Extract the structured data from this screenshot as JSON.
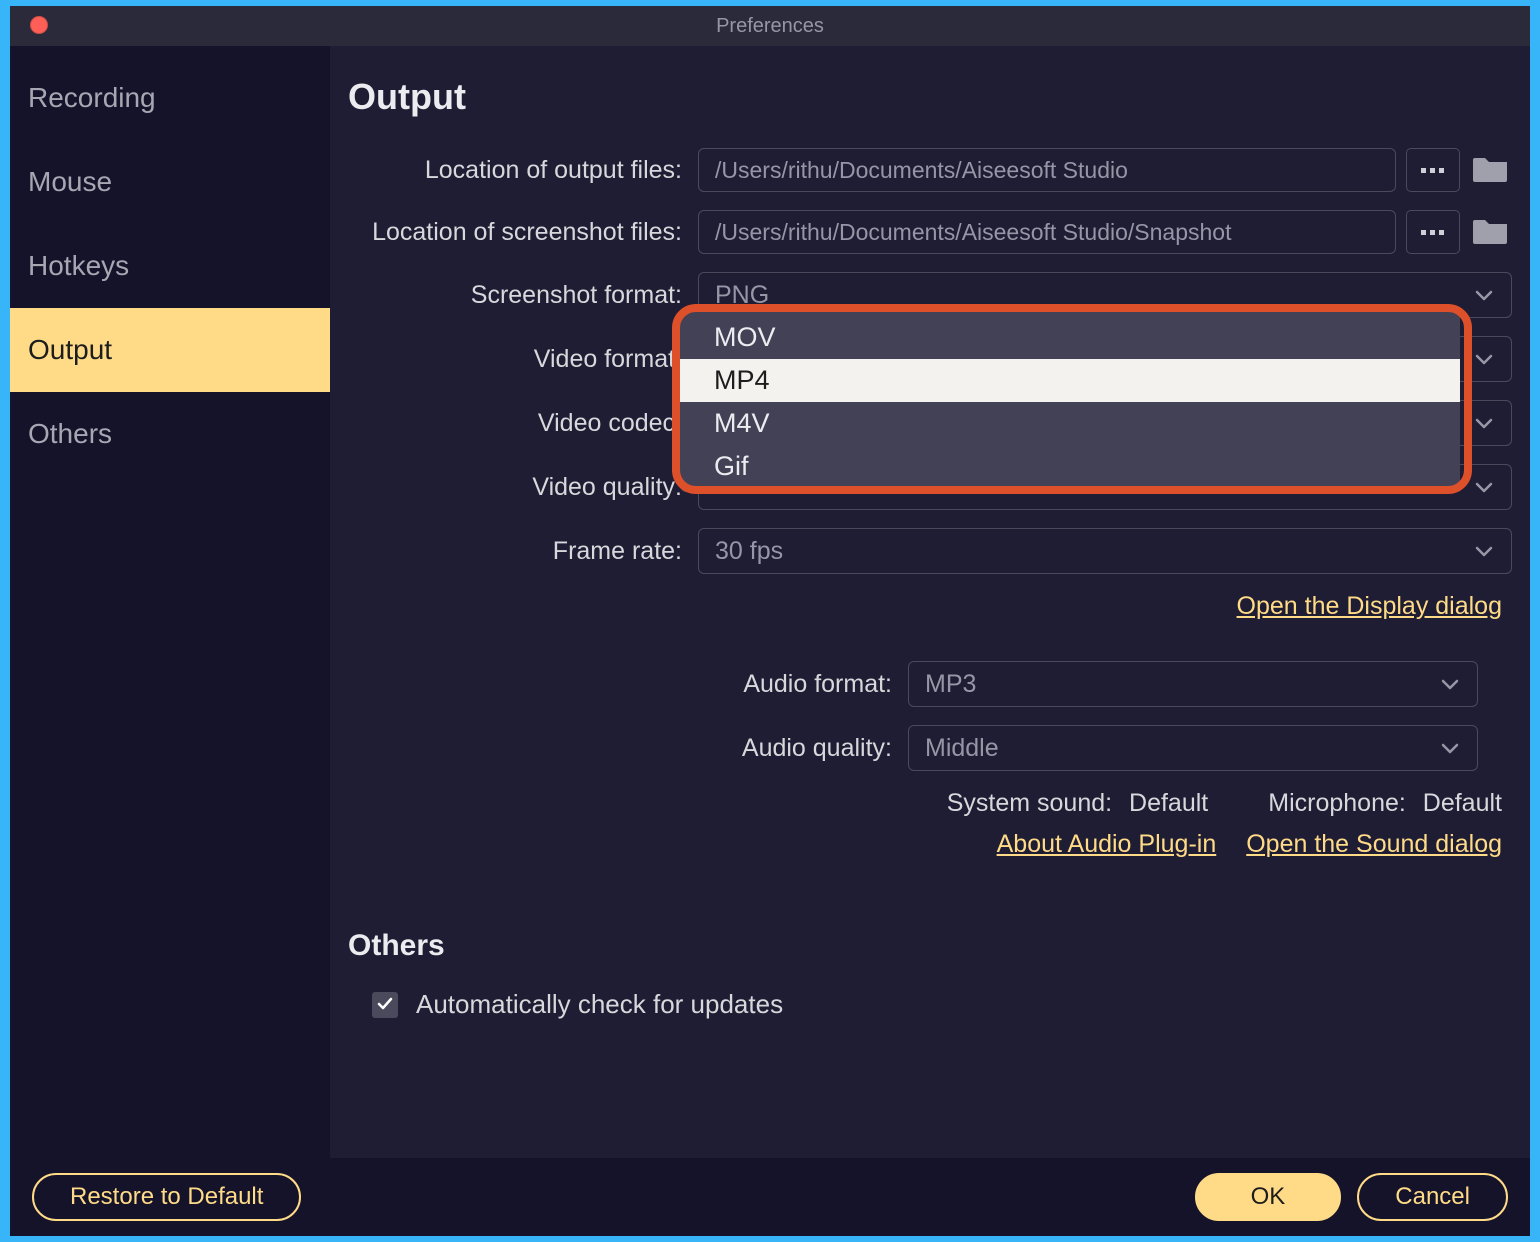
{
  "window": {
    "title": "Preferences"
  },
  "sidebar": {
    "items": [
      {
        "label": "Recording",
        "active": false
      },
      {
        "label": "Mouse",
        "active": false
      },
      {
        "label": "Hotkeys",
        "active": false
      },
      {
        "label": "Output",
        "active": true
      },
      {
        "label": "Others",
        "active": false
      }
    ]
  },
  "output": {
    "heading": "Output",
    "labels": {
      "output_files": "Location of output files:",
      "screenshot_files": "Location of screenshot files:",
      "screenshot_format": "Screenshot format:",
      "video_format": "Video format:",
      "video_codec": "Video codec:",
      "video_quality": "Video quality:",
      "frame_rate": "Frame rate:",
      "audio_format": "Audio format:",
      "audio_quality": "Audio quality:"
    },
    "values": {
      "output_files": "/Users/rithu/Documents/Aiseesoft Studio",
      "screenshot_files": "/Users/rithu/Documents/Aiseesoft Studio/Snapshot",
      "screenshot_format": "PNG",
      "frame_rate": "30 fps",
      "audio_format": "MP3",
      "audio_quality": "Middle"
    },
    "video_format_options": [
      "MOV",
      "MP4",
      "M4V",
      "Gif"
    ],
    "video_format_selected": "MP4",
    "links": {
      "display_dialog": "Open the Display dialog",
      "audio_plugin": "About Audio Plug-in",
      "sound_dialog": "Open the Sound dialog"
    },
    "system_sound_label": "System sound:",
    "system_sound_value": "Default",
    "microphone_label": "Microphone:",
    "microphone_value": "Default"
  },
  "others": {
    "heading": "Others",
    "auto_update_label": "Automatically check for updates",
    "auto_update_checked": true
  },
  "footer": {
    "restore": "Restore to Default",
    "ok": "OK",
    "cancel": "Cancel"
  }
}
